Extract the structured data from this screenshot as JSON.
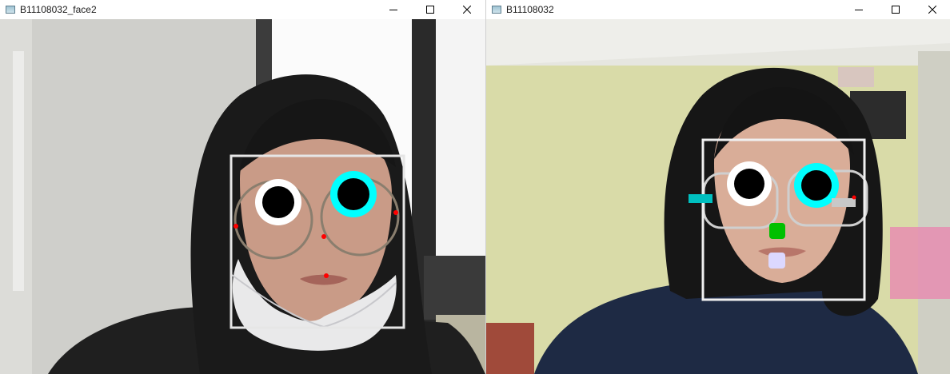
{
  "windows": [
    {
      "title": "B11108032_face2",
      "controls": [
        "minimize-icon",
        "maximize-icon",
        "close-icon"
      ]
    },
    {
      "title": "B11108032",
      "controls": [
        "minimize-icon",
        "maximize-icon",
        "close-icon"
      ]
    }
  ],
  "colors": {
    "face_box": "#e6e6e6",
    "left_eye_ring": "#ffffff",
    "right_eye_ring": "#00ffff",
    "pupil": "#000000",
    "landmark": "#ff0000",
    "nose_marker": "#00c000",
    "mouth_marker": "#dcd8ff",
    "cheek_bar_left": "#00c0c0",
    "cheek_bar_right": "#c8c8c8"
  }
}
